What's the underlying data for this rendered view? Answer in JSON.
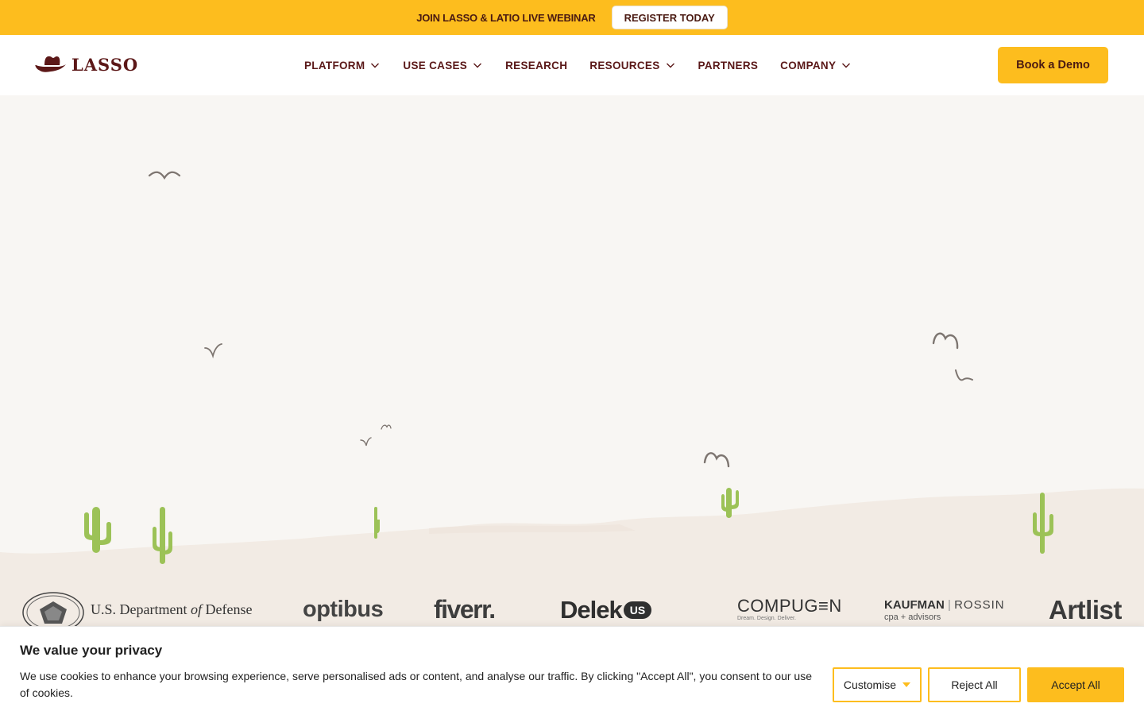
{
  "announcement": {
    "text": "JOIN LASSO & LATIO LIVE WEBINAR",
    "button_label": "REGISTER TODAY"
  },
  "header": {
    "logo_text": "LASSO",
    "nav": [
      {
        "label": "PLATFORM",
        "has_dropdown": true
      },
      {
        "label": "USE CASES",
        "has_dropdown": true
      },
      {
        "label": "RESEARCH",
        "has_dropdown": false
      },
      {
        "label": "RESOURCES",
        "has_dropdown": true
      },
      {
        "label": "PARTNERS",
        "has_dropdown": false
      },
      {
        "label": "COMPANY",
        "has_dropdown": true
      }
    ],
    "cta_label": "Book a Demo"
  },
  "client_logos": [
    {
      "name": "U.S. Department of Defense",
      "text_main": "U.S. Department ",
      "text_em": "of",
      "text_end": " Defense"
    },
    {
      "name": "optibus",
      "text": "optibus"
    },
    {
      "name": "fiverr",
      "text": "fiverr."
    },
    {
      "name": "Delek US",
      "text": "Delek",
      "badge": "US"
    },
    {
      "name": "COMPUGEN",
      "text": "COMPUG≡N",
      "tagline": "Dream. Design. Deliver."
    },
    {
      "name": "Kaufman Rossin",
      "text_left": "KAUFMAN",
      "text_right": "ROSSIN",
      "tagline": "cpa + advisors"
    },
    {
      "name": "Artlist",
      "text": "Artlist"
    }
  ],
  "cookie_banner": {
    "title": "We value your privacy",
    "text": "We use cookies to enhance your browsing experience, serve personalised ads or content, and analyse our traffic. By clicking \"Accept All\", you consent to our use of cookies.",
    "customise_label": "Customise",
    "reject_label": "Reject All",
    "accept_label": "Accept All"
  },
  "colors": {
    "brand_yellow": "#fdbd1e",
    "brand_maroon": "#5c1818",
    "background": "#f8f6f3",
    "ground": "#f2ebe4",
    "cactus": "#9cc257",
    "bird": "#7d7570"
  }
}
